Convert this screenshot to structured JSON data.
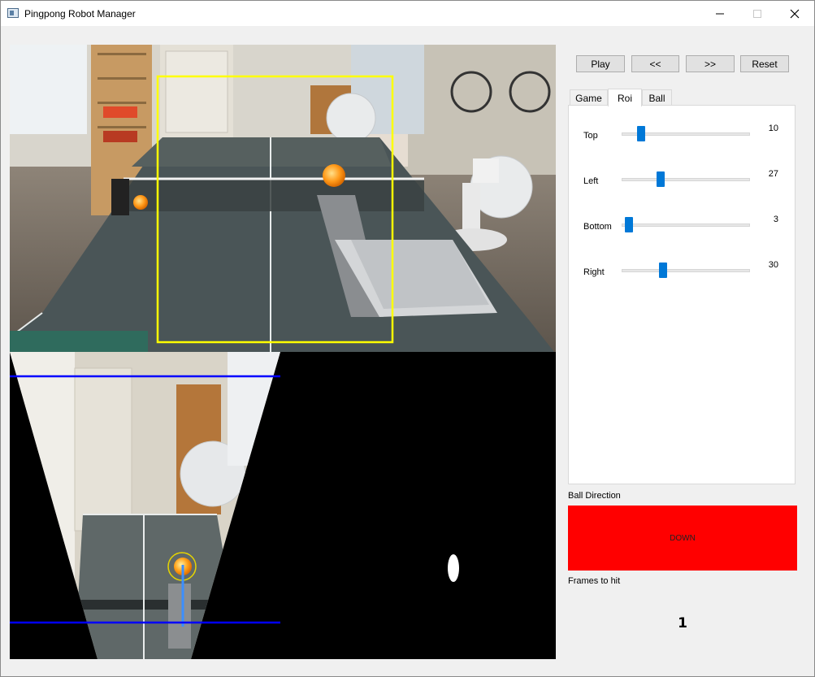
{
  "window": {
    "title": "Pingpong Robot Manager",
    "controls": {
      "minimize": "—",
      "maximize": "☐",
      "close": "✕"
    }
  },
  "toolbar": {
    "play_label": "Play",
    "prev_label": "<<",
    "next_label": ">>",
    "reset_label": "Reset"
  },
  "tabs": [
    {
      "label": "Game",
      "active": false
    },
    {
      "label": "Roi",
      "active": true
    },
    {
      "label": "Ball",
      "active": false
    }
  ],
  "roi": {
    "sliders": [
      {
        "label": "Top",
        "value": "10",
        "fraction": 0.13
      },
      {
        "label": "Left",
        "value": "27",
        "fraction": 0.29
      },
      {
        "label": "Bottom",
        "value": "3",
        "fraction": 0.03
      },
      {
        "label": "Right",
        "value": "30",
        "fraction": 0.31
      }
    ]
  },
  "ball_direction": {
    "label": "Ball Direction",
    "value": "DOWN",
    "color": "#ff0000"
  },
  "frames_to_hit": {
    "label": "Frames to hit",
    "value": "1"
  },
  "colors": {
    "roi_box": "#ffff00",
    "guide_lines": "#0000ff",
    "slider_thumb": "#0078d7"
  }
}
